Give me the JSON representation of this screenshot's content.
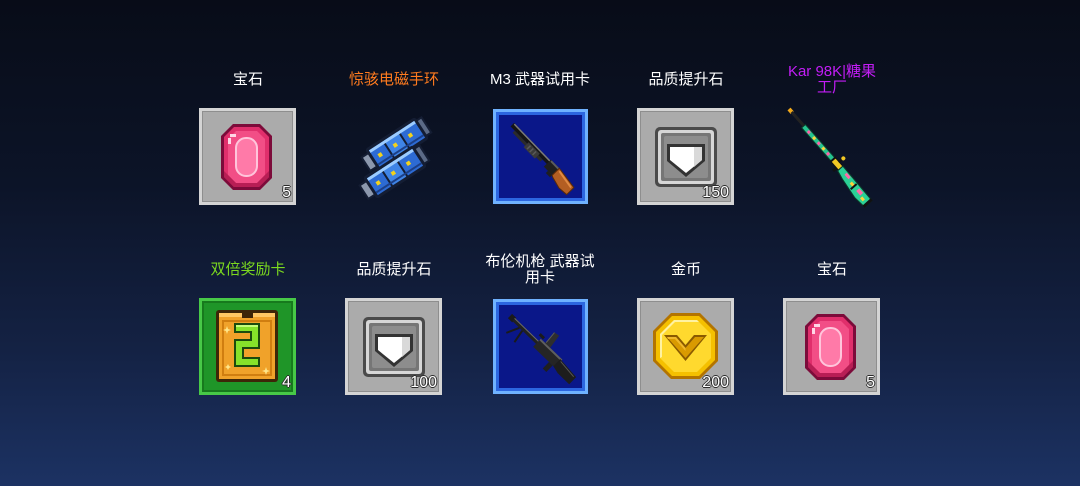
{
  "background": {
    "top": "#080c18",
    "bottom": "#1c3263"
  },
  "rewards": {
    "rows": [
      {
        "items": [
          {
            "label": "宝石",
            "label_color": "#ffffff",
            "icon": "pink-gem",
            "frame_color": "#ababab",
            "count": "5"
          },
          {
            "label": "惊骇电磁手环",
            "label_color": "#ff7b1f",
            "icon": "electromagnetic-gauntlets"
          },
          {
            "label": "M3 武器试用卡",
            "label_color": "#ffffff",
            "icon": "shotgun",
            "frame_color": "#0a1789"
          },
          {
            "label": "品质提升石",
            "label_color": "#ffffff",
            "icon": "quality-stone",
            "frame_color": "#ababab",
            "count": "150"
          },
          {
            "label": "Kar 98K|糖果工厂",
            "label_color": "#c21df5",
            "icon": "candy-rifle"
          }
        ]
      },
      {
        "items": [
          {
            "label": "双倍奖励卡",
            "label_color": "#7bd81f",
            "icon": "double-reward-card",
            "frame_color": "#1f9528",
            "count": "4"
          },
          {
            "label": "品质提升石",
            "label_color": "#ffffff",
            "icon": "quality-stone",
            "frame_color": "#ababab",
            "count": "100"
          },
          {
            "label": "布伦机枪 武器试用卡",
            "label_color": "#ffffff",
            "icon": "machine-gun",
            "frame_color": "#0a1789"
          },
          {
            "label": "金币",
            "label_color": "#ffffff",
            "icon": "gold-coin",
            "frame_color": "#ababab",
            "count": "200"
          },
          {
            "label": "宝石",
            "label_color": "#ffffff",
            "icon": "pink-gem",
            "frame_color": "#ababab",
            "count": "5"
          }
        ]
      }
    ]
  }
}
